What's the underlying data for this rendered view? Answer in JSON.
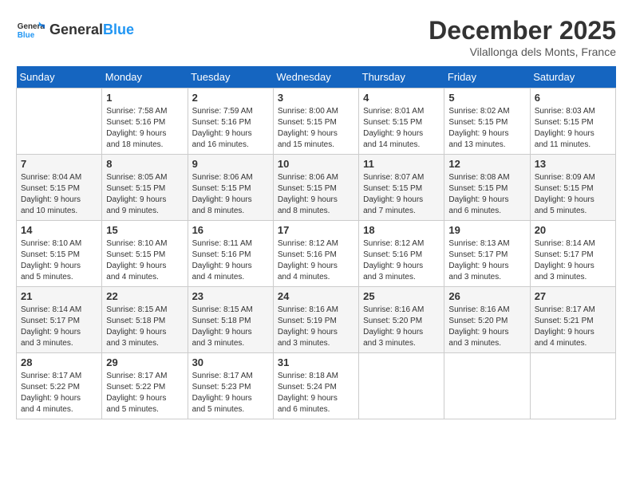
{
  "header": {
    "logo_general": "General",
    "logo_blue": "Blue",
    "month_year": "December 2025",
    "location": "Vilallonga dels Monts, France"
  },
  "columns": [
    "Sunday",
    "Monday",
    "Tuesday",
    "Wednesday",
    "Thursday",
    "Friday",
    "Saturday"
  ],
  "weeks": [
    [
      {
        "day": "",
        "info": ""
      },
      {
        "day": "1",
        "info": "Sunrise: 7:58 AM\nSunset: 5:16 PM\nDaylight: 9 hours\nand 18 minutes."
      },
      {
        "day": "2",
        "info": "Sunrise: 7:59 AM\nSunset: 5:16 PM\nDaylight: 9 hours\nand 16 minutes."
      },
      {
        "day": "3",
        "info": "Sunrise: 8:00 AM\nSunset: 5:15 PM\nDaylight: 9 hours\nand 15 minutes."
      },
      {
        "day": "4",
        "info": "Sunrise: 8:01 AM\nSunset: 5:15 PM\nDaylight: 9 hours\nand 14 minutes."
      },
      {
        "day": "5",
        "info": "Sunrise: 8:02 AM\nSunset: 5:15 PM\nDaylight: 9 hours\nand 13 minutes."
      },
      {
        "day": "6",
        "info": "Sunrise: 8:03 AM\nSunset: 5:15 PM\nDaylight: 9 hours\nand 11 minutes."
      }
    ],
    [
      {
        "day": "7",
        "info": "Sunrise: 8:04 AM\nSunset: 5:15 PM\nDaylight: 9 hours\nand 10 minutes."
      },
      {
        "day": "8",
        "info": "Sunrise: 8:05 AM\nSunset: 5:15 PM\nDaylight: 9 hours\nand 9 minutes."
      },
      {
        "day": "9",
        "info": "Sunrise: 8:06 AM\nSunset: 5:15 PM\nDaylight: 9 hours\nand 8 minutes."
      },
      {
        "day": "10",
        "info": "Sunrise: 8:06 AM\nSunset: 5:15 PM\nDaylight: 9 hours\nand 8 minutes."
      },
      {
        "day": "11",
        "info": "Sunrise: 8:07 AM\nSunset: 5:15 PM\nDaylight: 9 hours\nand 7 minutes."
      },
      {
        "day": "12",
        "info": "Sunrise: 8:08 AM\nSunset: 5:15 PM\nDaylight: 9 hours\nand 6 minutes."
      },
      {
        "day": "13",
        "info": "Sunrise: 8:09 AM\nSunset: 5:15 PM\nDaylight: 9 hours\nand 5 minutes."
      }
    ],
    [
      {
        "day": "14",
        "info": "Sunrise: 8:10 AM\nSunset: 5:15 PM\nDaylight: 9 hours\nand 5 minutes."
      },
      {
        "day": "15",
        "info": "Sunrise: 8:10 AM\nSunset: 5:15 PM\nDaylight: 9 hours\nand 4 minutes."
      },
      {
        "day": "16",
        "info": "Sunrise: 8:11 AM\nSunset: 5:16 PM\nDaylight: 9 hours\nand 4 minutes."
      },
      {
        "day": "17",
        "info": "Sunrise: 8:12 AM\nSunset: 5:16 PM\nDaylight: 9 hours\nand 4 minutes."
      },
      {
        "day": "18",
        "info": "Sunrise: 8:12 AM\nSunset: 5:16 PM\nDaylight: 9 hours\nand 3 minutes."
      },
      {
        "day": "19",
        "info": "Sunrise: 8:13 AM\nSunset: 5:17 PM\nDaylight: 9 hours\nand 3 minutes."
      },
      {
        "day": "20",
        "info": "Sunrise: 8:14 AM\nSunset: 5:17 PM\nDaylight: 9 hours\nand 3 minutes."
      }
    ],
    [
      {
        "day": "21",
        "info": "Sunrise: 8:14 AM\nSunset: 5:17 PM\nDaylight: 9 hours\nand 3 minutes."
      },
      {
        "day": "22",
        "info": "Sunrise: 8:15 AM\nSunset: 5:18 PM\nDaylight: 9 hours\nand 3 minutes."
      },
      {
        "day": "23",
        "info": "Sunrise: 8:15 AM\nSunset: 5:18 PM\nDaylight: 9 hours\nand 3 minutes."
      },
      {
        "day": "24",
        "info": "Sunrise: 8:16 AM\nSunset: 5:19 PM\nDaylight: 9 hours\nand 3 minutes."
      },
      {
        "day": "25",
        "info": "Sunrise: 8:16 AM\nSunset: 5:20 PM\nDaylight: 9 hours\nand 3 minutes."
      },
      {
        "day": "26",
        "info": "Sunrise: 8:16 AM\nSunset: 5:20 PM\nDaylight: 9 hours\nand 3 minutes."
      },
      {
        "day": "27",
        "info": "Sunrise: 8:17 AM\nSunset: 5:21 PM\nDaylight: 9 hours\nand 4 minutes."
      }
    ],
    [
      {
        "day": "28",
        "info": "Sunrise: 8:17 AM\nSunset: 5:22 PM\nDaylight: 9 hours\nand 4 minutes."
      },
      {
        "day": "29",
        "info": "Sunrise: 8:17 AM\nSunset: 5:22 PM\nDaylight: 9 hours\nand 5 minutes."
      },
      {
        "day": "30",
        "info": "Sunrise: 8:17 AM\nSunset: 5:23 PM\nDaylight: 9 hours\nand 5 minutes."
      },
      {
        "day": "31",
        "info": "Sunrise: 8:18 AM\nSunset: 5:24 PM\nDaylight: 9 hours\nand 6 minutes."
      },
      {
        "day": "",
        "info": ""
      },
      {
        "day": "",
        "info": ""
      },
      {
        "day": "",
        "info": ""
      }
    ]
  ]
}
